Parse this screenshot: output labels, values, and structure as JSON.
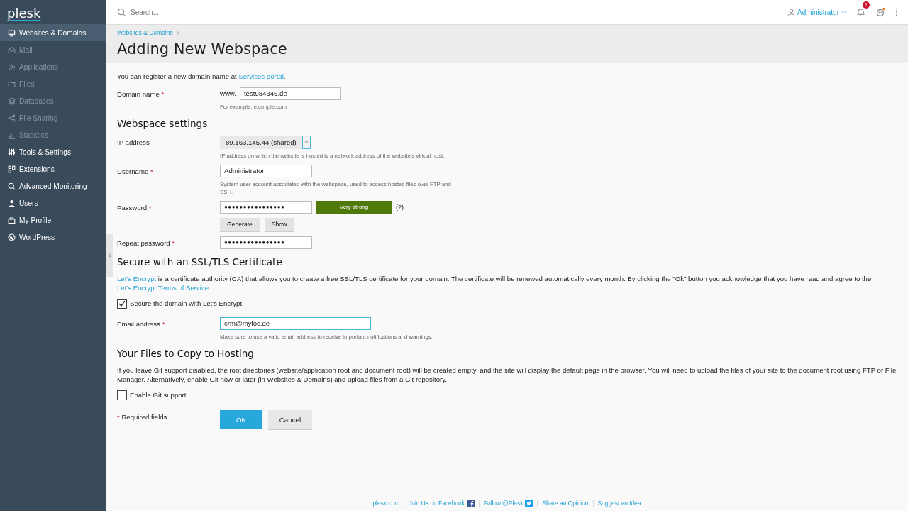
{
  "logo": "plesk",
  "sidebar": {
    "items": [
      {
        "label": "Websites & Domains",
        "selected": true,
        "disabled": false
      },
      {
        "label": "Mail",
        "selected": false,
        "disabled": true
      },
      {
        "label": "Applications",
        "selected": false,
        "disabled": true
      },
      {
        "label": "Files",
        "selected": false,
        "disabled": true
      },
      {
        "label": "Databases",
        "selected": false,
        "disabled": true
      },
      {
        "label": "File Sharing",
        "selected": false,
        "disabled": true
      },
      {
        "label": "Statistics",
        "selected": false,
        "disabled": true
      },
      {
        "label": "Tools & Settings",
        "selected": false,
        "disabled": false
      },
      {
        "label": "Extensions",
        "selected": false,
        "disabled": false
      },
      {
        "label": "Advanced Monitoring",
        "selected": false,
        "disabled": false
      },
      {
        "label": "Users",
        "selected": false,
        "disabled": false
      },
      {
        "label": "My Profile",
        "selected": false,
        "disabled": false
      },
      {
        "label": "WordPress",
        "selected": false,
        "disabled": false
      }
    ]
  },
  "topbar": {
    "search_placeholder": "Search...",
    "user": "Administrator",
    "notifications": "1"
  },
  "breadcrumb": "Websites & Domains",
  "title": "Adding New Webspace",
  "intro": {
    "text": "You can register a new domain name at ",
    "link": "Services portal",
    "end": "."
  },
  "required_mark": "*",
  "domain": {
    "label": "Domain name",
    "required": true,
    "prefix": "www.",
    "value": "test984345.de",
    "hint": "For example, example.com"
  },
  "webspace": {
    "heading": "Webspace settings",
    "ip": {
      "label": "IP address",
      "required": false,
      "value": "89.163.145.44 (shared)",
      "hint": "IP address on which the website is hosted is a network address of the website's virtual host."
    },
    "username": {
      "label": "Username",
      "required": true,
      "value": "Administrator",
      "hint": "System user account associated with the webspace, used to access hosted files over FTP and SSH."
    },
    "password": {
      "label": "Password",
      "required": true,
      "value": "●●●●●●●●●●●●●●●●",
      "strength": "Very strong",
      "help": "(?)",
      "buttons": [
        "Generate",
        "Show"
      ]
    },
    "repeat": {
      "label": "Repeat password",
      "required": true,
      "value": "●●●●●●●●●●●●●●●●"
    }
  },
  "ssl": {
    "heading": "Secure with an SSL/TLS Certificate",
    "link": "Let's Encrypt",
    "text": " is a certificate authority (CA) that allows you to create a free SSL/TLS certificate for your domain. The certificate will be renewed automatically every month. By clicking the \"Ok\" button you acknowledge that you have read and agree to the ",
    "terms": "Let's Encrypt Terms of Service",
    "end": ".",
    "checkbox": {
      "label": "Secure the domain with Let's Encrypt",
      "checked": true
    },
    "email": {
      "label": "Email address",
      "required": true,
      "value": "crm@myloc.de",
      "hint": "Make sure to use a valid email address to receive important notifications and warnings."
    }
  },
  "files": {
    "heading": "Your Files to Copy to Hosting",
    "text": "If you leave Git support disabled, the root directories (website/application root and document root) will be created empty, and the site will display the default page in the browser. You will need to upload the files of your site to the document root using FTP or File Manager. Alternatively, enable Git now or later (in Websites & Domains) and upload files from a Git repository.",
    "checkbox": {
      "label": "Enable Git support",
      "checked": false
    }
  },
  "required_note": "Required fields",
  "buttons": [
    {
      "label": "OK",
      "kind": "primary"
    },
    {
      "label": "Cancel",
      "kind": "secondary"
    }
  ],
  "footer": [
    "plesk.com",
    "Join Us on Facebook",
    "Follow @Plesk",
    "Share an Opinion",
    "Suggest an Idea"
  ]
}
